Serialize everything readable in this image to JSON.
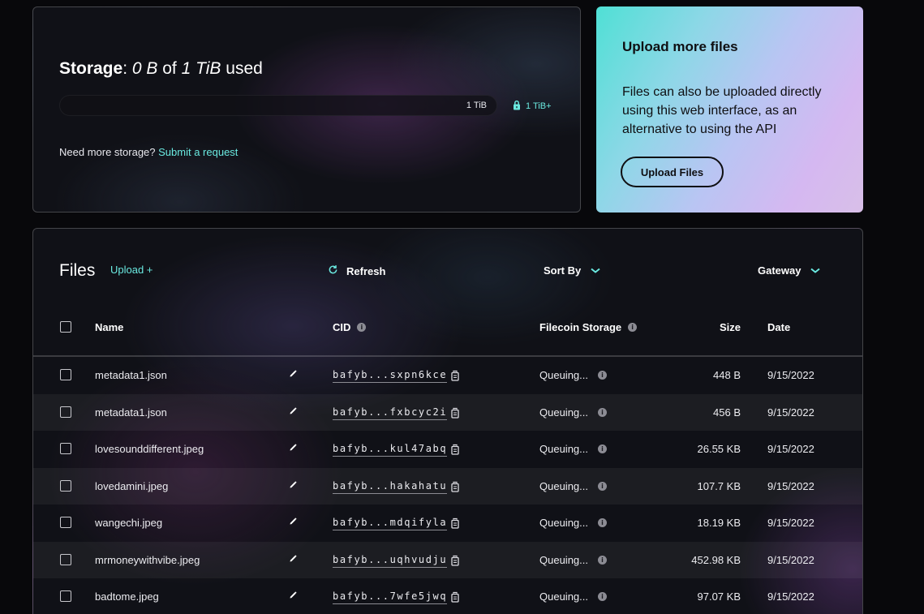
{
  "storage": {
    "label": "Storage",
    "used": "0 B",
    "of": "of",
    "total": "1 TiB",
    "used_word": "used",
    "bar_label": "1 TiB",
    "bar_fill_fraction": 0,
    "upgrade_label": "1 TiB+",
    "more_prompt": "Need more storage?",
    "request_link": "Submit a request"
  },
  "upload_card": {
    "title": "Upload more files",
    "description": "Files can also be uploaded directly using this web interface, as an alternative to using the API",
    "button": "Upload Files"
  },
  "files": {
    "title": "Files",
    "upload_link": "Upload +",
    "refresh": "Refresh",
    "sort_by": "Sort By",
    "gateway": "Gateway",
    "columns": {
      "name": "Name",
      "cid": "CID",
      "filecoin": "Filecoin Storage",
      "size": "Size",
      "date": "Date"
    },
    "rows": [
      {
        "name": "metadata1.json",
        "cid": "bafyb...sxpn6kce",
        "status": "Queuing...",
        "size": "448 B",
        "date": "9/15/2022"
      },
      {
        "name": "metadata1.json",
        "cid": "bafyb...fxbcyc2i",
        "status": "Queuing...",
        "size": "456 B",
        "date": "9/15/2022"
      },
      {
        "name": "lovesounddifferent.jpeg",
        "cid": "bafyb...kul47abq",
        "status": "Queuing...",
        "size": "26.55 KB",
        "date": "9/15/2022"
      },
      {
        "name": "lovedamini.jpeg",
        "cid": "bafyb...hakahatu",
        "status": "Queuing...",
        "size": "107.7 KB",
        "date": "9/15/2022"
      },
      {
        "name": "wangechi.jpeg",
        "cid": "bafyb...mdqifyla",
        "status": "Queuing...",
        "size": "18.19 KB",
        "date": "9/15/2022"
      },
      {
        "name": "mrmoneywithvibe.jpeg",
        "cid": "bafyb...uqhvudju",
        "status": "Queuing...",
        "size": "452.98 KB",
        "date": "9/15/2022"
      },
      {
        "name": "badtome.jpeg",
        "cid": "bafyb...7wfe5jwq",
        "status": "Queuing...",
        "size": "97.07 KB",
        "date": "9/15/2022"
      }
    ]
  },
  "colors": {
    "accent": "#6ae9e0",
    "background": "#08080b"
  }
}
